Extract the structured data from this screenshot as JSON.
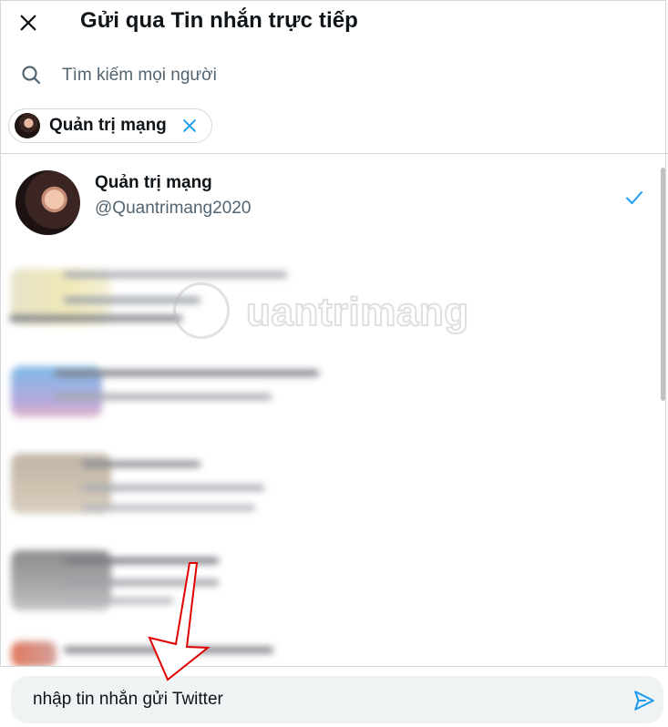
{
  "header": {
    "title": "Gửi qua Tin nhắn trực tiếp",
    "close_icon": "close-icon"
  },
  "search": {
    "placeholder": "Tìm kiếm mọi người",
    "icon": "search-icon"
  },
  "selected_chip": {
    "label": "Quản trị mạng",
    "remove_icon": "close-icon"
  },
  "results": [
    {
      "name": "Quản trị mạng",
      "handle": "@Quantrimang2020",
      "selected": true,
      "check_icon": "check-icon"
    }
  ],
  "watermark": {
    "text": "uantrimang"
  },
  "composer": {
    "value": "nhập tin nhắn gửi Twitter",
    "send_icon": "send-icon"
  },
  "colors": {
    "accent": "#1d9bf0",
    "annotation_arrow": "#e00000",
    "text_primary": "#0f1419",
    "text_secondary": "#536471"
  }
}
